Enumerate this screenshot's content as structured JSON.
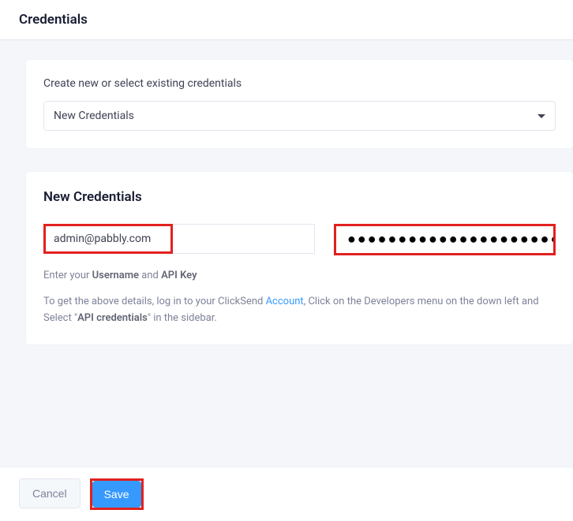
{
  "header": {
    "title": "Credentials"
  },
  "selector": {
    "label": "Create new or select existing credentials",
    "selected": "New Credentials"
  },
  "form": {
    "title": "New Credentials",
    "username_value": "admin@pabbly.com",
    "apikey_masked": "●●●●●●●●●●●●●●●●●●●●●●●●●●●●●●●●",
    "help_prefix": "Enter your ",
    "help_username": "Username",
    "help_and": " and ",
    "help_apikey": "API Key",
    "info_part1": "To get the above details, log in to your ClickSend ",
    "info_link": "Account",
    "info_part2": ", Click on the Developers menu on the down left and Select \"",
    "info_bold": "API credentials",
    "info_part3": "\" in the sidebar."
  },
  "footer": {
    "cancel": "Cancel",
    "save": "Save"
  }
}
